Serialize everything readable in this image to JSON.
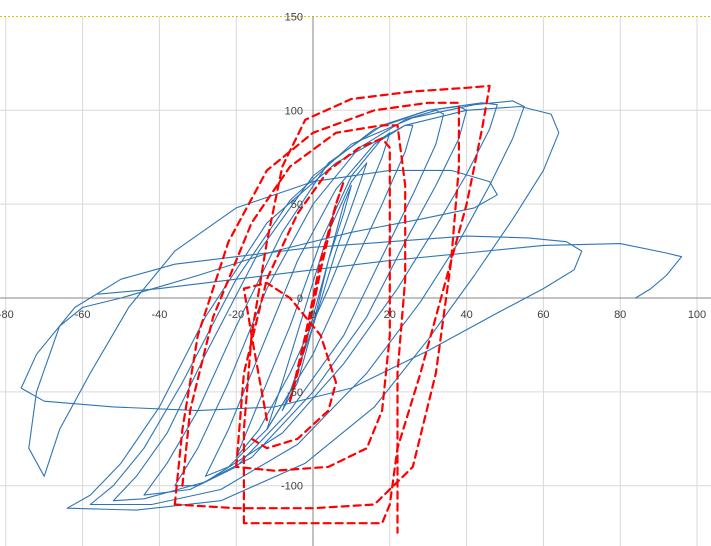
{
  "chart_data": {
    "type": "line",
    "title": "",
    "xlabel": "",
    "ylabel": "",
    "xlim": [
      -80,
      100
    ],
    "ylim": [
      -130,
      150
    ],
    "x_ticks": [
      -80,
      -60,
      -40,
      -20,
      0,
      20,
      40,
      60,
      80,
      100
    ],
    "y_ticks": [
      -100,
      -50,
      0,
      50,
      100,
      150
    ],
    "x_tick_labels": [
      "-80",
      "-60",
      "-40",
      "-20",
      "0",
      "20",
      "40",
      "60",
      "80",
      "100"
    ],
    "y_tick_labels": [
      "-100",
      "-50",
      "0",
      "50",
      "100",
      "150"
    ],
    "grid": true,
    "legend": "none",
    "series": [
      {
        "color": "#2e75b6",
        "style": "solid",
        "loops": [
          [
            [
              -8,
              -60
            ],
            [
              -4,
              -40
            ],
            [
              0,
              -10
            ],
            [
              4,
              20
            ],
            [
              8,
              45
            ],
            [
              10,
              60
            ],
            [
              8,
              50
            ],
            [
              4,
              20
            ],
            [
              0,
              -15
            ],
            [
              -4,
              -45
            ],
            [
              -8,
              -60
            ]
          ],
          [
            [
              -12,
              -70
            ],
            [
              -8,
              -45
            ],
            [
              -2,
              -5
            ],
            [
              4,
              35
            ],
            [
              10,
              62
            ],
            [
              14,
              72
            ],
            [
              12,
              60
            ],
            [
              6,
              25
            ],
            [
              0,
              -15
            ],
            [
              -6,
              -50
            ],
            [
              -12,
              -70
            ]
          ],
          [
            [
              -20,
              -85
            ],
            [
              -14,
              -55
            ],
            [
              -6,
              -15
            ],
            [
              2,
              30
            ],
            [
              10,
              65
            ],
            [
              18,
              85
            ],
            [
              20,
              88
            ],
            [
              18,
              75
            ],
            [
              12,
              45
            ],
            [
              4,
              5
            ],
            [
              -6,
              -40
            ],
            [
              -14,
              -70
            ],
            [
              -20,
              -85
            ]
          ],
          [
            [
              -28,
              -95
            ],
            [
              -22,
              -70
            ],
            [
              -14,
              -30
            ],
            [
              -4,
              20
            ],
            [
              6,
              58
            ],
            [
              16,
              82
            ],
            [
              24,
              92
            ],
            [
              26,
              92
            ],
            [
              24,
              78
            ],
            [
              18,
              50
            ],
            [
              10,
              15
            ],
            [
              0,
              -30
            ],
            [
              -12,
              -70
            ],
            [
              -22,
              -90
            ],
            [
              -28,
              -95
            ]
          ],
          [
            [
              -36,
              -100
            ],
            [
              -30,
              -80
            ],
            [
              -22,
              -45
            ],
            [
              -12,
              5
            ],
            [
              0,
              50
            ],
            [
              12,
              80
            ],
            [
              24,
              95
            ],
            [
              32,
              100
            ],
            [
              34,
              98
            ],
            [
              32,
              82
            ],
            [
              26,
              55
            ],
            [
              18,
              22
            ],
            [
              8,
              -20
            ],
            [
              -6,
              -60
            ],
            [
              -20,
              -90
            ],
            [
              -30,
              -100
            ],
            [
              -36,
              -100
            ]
          ],
          [
            [
              -44,
              -105
            ],
            [
              -38,
              -88
            ],
            [
              -30,
              -60
            ],
            [
              -20,
              -15
            ],
            [
              -8,
              35
            ],
            [
              4,
              72
            ],
            [
              18,
              92
            ],
            [
              30,
              100
            ],
            [
              38,
              102
            ],
            [
              40,
              100
            ],
            [
              38,
              85
            ],
            [
              32,
              60
            ],
            [
              24,
              30
            ],
            [
              14,
              -10
            ],
            [
              0,
              -50
            ],
            [
              -16,
              -85
            ],
            [
              -32,
              -102
            ],
            [
              -44,
              -105
            ]
          ],
          [
            [
              -52,
              -108
            ],
            [
              -46,
              -95
            ],
            [
              -38,
              -72
            ],
            [
              -28,
              -30
            ],
            [
              -14,
              25
            ],
            [
              0,
              65
            ],
            [
              16,
              90
            ],
            [
              30,
              100
            ],
            [
              44,
              104
            ],
            [
              48,
              103
            ],
            [
              46,
              90
            ],
            [
              40,
              66
            ],
            [
              32,
              38
            ],
            [
              22,
              5
            ],
            [
              8,
              -35
            ],
            [
              -8,
              -72
            ],
            [
              -28,
              -98
            ],
            [
              -44,
              -107
            ],
            [
              -52,
              -108
            ]
          ],
          [
            [
              -58,
              -110
            ],
            [
              -52,
              -100
            ],
            [
              -44,
              -80
            ],
            [
              -34,
              -45
            ],
            [
              -20,
              10
            ],
            [
              -6,
              52
            ],
            [
              10,
              82
            ],
            [
              26,
              96
            ],
            [
              42,
              103
            ],
            [
              52,
              105
            ],
            [
              55,
              102
            ],
            [
              52,
              85
            ],
            [
              46,
              60
            ],
            [
              38,
              30
            ],
            [
              28,
              -2
            ],
            [
              14,
              -40
            ],
            [
              -4,
              -78
            ],
            [
              -24,
              -102
            ],
            [
              -42,
              -110
            ],
            [
              -58,
              -110
            ]
          ],
          [
            [
              -64,
              -112
            ],
            [
              -58,
              -105
            ],
            [
              -50,
              -88
            ],
            [
              -40,
              -58
            ],
            [
              -28,
              -10
            ],
            [
              -12,
              40
            ],
            [
              6,
              72
            ],
            [
              24,
              92
            ],
            [
              40,
              100
            ],
            [
              54,
              102
            ],
            [
              62,
              98
            ],
            [
              64,
              88
            ],
            [
              60,
              68
            ],
            [
              52,
              42
            ],
            [
              42,
              12
            ],
            [
              30,
              -22
            ],
            [
              16,
              -58
            ],
            [
              -2,
              -88
            ],
            [
              -24,
              -108
            ],
            [
              -46,
              -113
            ],
            [
              -64,
              -112
            ]
          ],
          [
            [
              -70,
              -95
            ],
            [
              -66,
              -70
            ],
            [
              -58,
              -40
            ],
            [
              -48,
              -5
            ],
            [
              -36,
              25
            ],
            [
              -20,
              48
            ],
            [
              0,
              62
            ],
            [
              20,
              68
            ],
            [
              36,
              68
            ],
            [
              46,
              62
            ],
            [
              48,
              55
            ],
            [
              42,
              48
            ],
            [
              28,
              42
            ],
            [
              10,
              35
            ],
            [
              -10,
              25
            ],
            [
              -30,
              12
            ],
            [
              -50,
              0
            ],
            [
              -60,
              -5
            ],
            [
              -66,
              -15
            ],
            [
              -72,
              -50
            ],
            [
              -74,
              -80
            ],
            [
              -70,
              -95
            ]
          ],
          [
            [
              -76,
              -48
            ],
            [
              -72,
              -30
            ],
            [
              -62,
              -5
            ],
            [
              -50,
              10
            ],
            [
              -36,
              18
            ],
            [
              -20,
              22
            ],
            [
              0,
              27
            ],
            [
              20,
              30
            ],
            [
              40,
              33
            ],
            [
              56,
              32
            ],
            [
              66,
              30
            ],
            [
              70,
              25
            ],
            [
              68,
              15
            ],
            [
              60,
              5
            ],
            [
              48,
              -8
            ],
            [
              30,
              -28
            ],
            [
              10,
              -48
            ],
            [
              -10,
              -58
            ],
            [
              -30,
              -60
            ],
            [
              -52,
              -58
            ],
            [
              -70,
              -55
            ],
            [
              -76,
              -48
            ]
          ],
          [
            [
              -56,
              2
            ],
            [
              -40,
              5
            ],
            [
              -20,
              10
            ],
            [
              0,
              15
            ],
            [
              20,
              20
            ],
            [
              40,
              24
            ],
            [
              60,
              28
            ],
            [
              80,
              29
            ],
            [
              92,
              24
            ],
            [
              96,
              22
            ],
            [
              92,
              12
            ],
            [
              88,
              5
            ],
            [
              84,
              0
            ]
          ]
        ]
      },
      {
        "color": "#ff0000",
        "style": "dashed",
        "loops": [
          [
            [
              -6,
              -55
            ],
            [
              -2,
              -20
            ],
            [
              2,
              20
            ],
            [
              6,
              50
            ],
            [
              8,
              62
            ],
            [
              6,
              50
            ],
            [
              2,
              15
            ],
            [
              -2,
              -25
            ],
            [
              -6,
              -55
            ]
          ],
          [
            [
              -12,
              -65
            ],
            [
              -16,
              -20
            ],
            [
              -18,
              5
            ],
            [
              -12,
              8
            ],
            [
              -6,
              0
            ],
            [
              2,
              -20
            ],
            [
              6,
              -45
            ],
            [
              4,
              -60
            ],
            [
              -4,
              -75
            ],
            [
              -12,
              -80
            ],
            [
              -16,
              -75
            ]
          ],
          [
            [
              -20,
              -90
            ],
            [
              -18,
              -40
            ],
            [
              -12,
              10
            ],
            [
              -4,
              45
            ],
            [
              4,
              68
            ],
            [
              12,
              80
            ],
            [
              18,
              85
            ],
            [
              20,
              80
            ],
            [
              20,
              40
            ],
            [
              20,
              -20
            ],
            [
              18,
              -60
            ],
            [
              14,
              -80
            ],
            [
              4,
              -90
            ],
            [
              -10,
              -92
            ],
            [
              -20,
              -90
            ]
          ],
          [
            [
              -34,
              -100
            ],
            [
              -32,
              -60
            ],
            [
              -26,
              -10
            ],
            [
              -16,
              40
            ],
            [
              -6,
              70
            ],
            [
              6,
              88
            ],
            [
              18,
              92
            ],
            [
              22,
              92
            ],
            [
              24,
              60
            ],
            [
              24,
              10
            ],
            [
              22,
              -40
            ],
            [
              22,
              -100
            ],
            [
              22,
              -125
            ]
          ],
          [
            [
              -36,
              -110
            ],
            [
              -34,
              -70
            ],
            [
              -30,
              -20
            ],
            [
              -22,
              30
            ],
            [
              -12,
              68
            ],
            [
              0,
              88
            ],
            [
              16,
              100
            ],
            [
              30,
              104
            ],
            [
              38,
              104
            ],
            [
              38,
              70
            ],
            [
              36,
              20
            ],
            [
              32,
              -40
            ],
            [
              26,
              -90
            ],
            [
              16,
              -110
            ],
            [
              0,
              -112
            ],
            [
              -20,
              -112
            ],
            [
              -36,
              -110
            ]
          ],
          [
            [
              -18,
              -120
            ],
            [
              -18,
              -70
            ],
            [
              -16,
              -20
            ],
            [
              -12,
              30
            ],
            [
              -8,
              70
            ],
            [
              -2,
              95
            ],
            [
              10,
              106
            ],
            [
              26,
              110
            ],
            [
              40,
              112
            ],
            [
              46,
              113
            ],
            [
              44,
              90
            ],
            [
              40,
              50
            ],
            [
              34,
              5
            ],
            [
              28,
              -40
            ],
            [
              22,
              -80
            ],
            [
              20,
              -110
            ],
            [
              18,
              -120
            ],
            [
              0,
              -120
            ],
            [
              -18,
              -120
            ]
          ]
        ]
      }
    ]
  }
}
